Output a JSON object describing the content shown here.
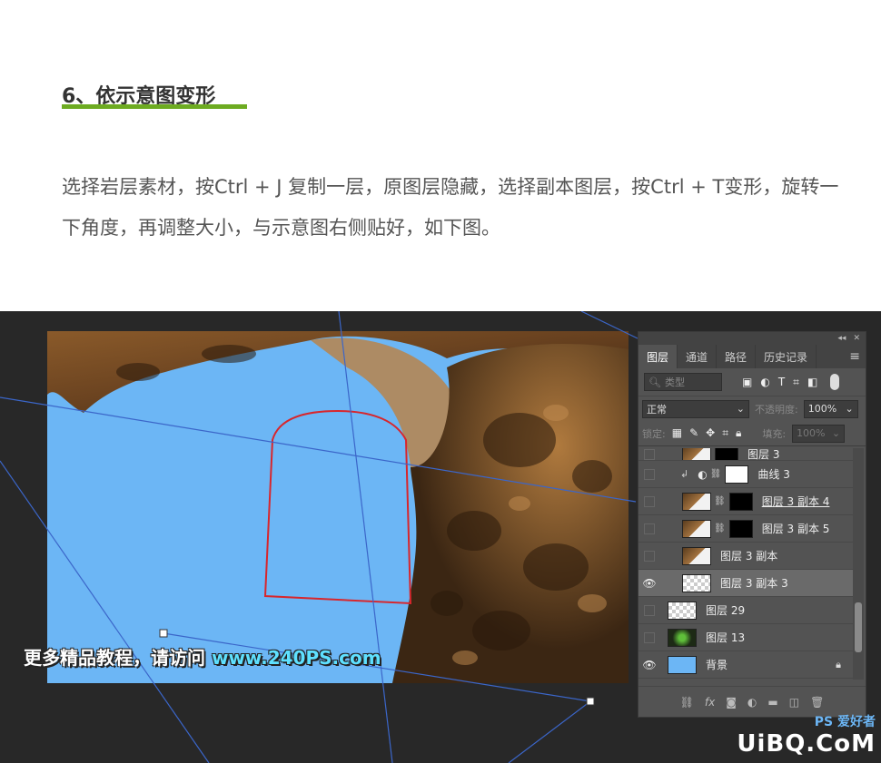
{
  "article": {
    "step_title": "6、依示意图变形",
    "paragraph": "选择岩层素材，按Ctrl + J 复制一层，原图层隐藏，选择副本图层，按Ctrl + T变形，旋转一下角度，再调整大小，与示意图右侧贴好，如下图。",
    "accent_color": "#6dab21"
  },
  "watermark": {
    "text": "更多精品教程，请访问",
    "url": "www.240PS.com"
  },
  "layers_panel": {
    "tabs": [
      "图层",
      "通道",
      "路径",
      "历史记录"
    ],
    "active_tab": "图层",
    "filter_placeholder": "类型",
    "blend_mode": "正常",
    "opacity_label": "不透明度:",
    "opacity_value": "100%",
    "lock_label": "锁定:",
    "fill_label": "填充:",
    "fill_value": "100%",
    "layers": [
      {
        "name": "图层 3",
        "visible": false,
        "thumb": "rock",
        "mask": "dark",
        "selected": false,
        "clipped": false
      },
      {
        "name": "曲线 3",
        "visible": false,
        "thumb": "adjust",
        "mask": "curve",
        "selected": false,
        "clipped": true
      },
      {
        "name": "图层 3 副本 4",
        "visible": false,
        "thumb": "rock",
        "mask": "dark",
        "selected": false,
        "underlined": true
      },
      {
        "name": "图层 3 副本 5",
        "visible": false,
        "thumb": "rock",
        "mask": "dark",
        "selected": false
      },
      {
        "name": "图层 3 副本",
        "visible": false,
        "thumb": "rock",
        "mask": "none",
        "selected": false
      },
      {
        "name": "图层 3 副本 3",
        "visible": true,
        "thumb": "checker",
        "mask": "none",
        "selected": true
      },
      {
        "name": "图层 29",
        "visible": false,
        "thumb": "checker",
        "mask": "none",
        "selected": false
      },
      {
        "name": "图层 13",
        "visible": false,
        "thumb": "green",
        "mask": "none",
        "selected": false
      },
      {
        "name": "背景",
        "visible": true,
        "thumb": "blue",
        "mask": "none",
        "selected": false,
        "locked": true
      }
    ]
  },
  "corner_logo": {
    "ps_text": "PS 爱好者",
    "site_text": "UiBQ.CoM"
  }
}
